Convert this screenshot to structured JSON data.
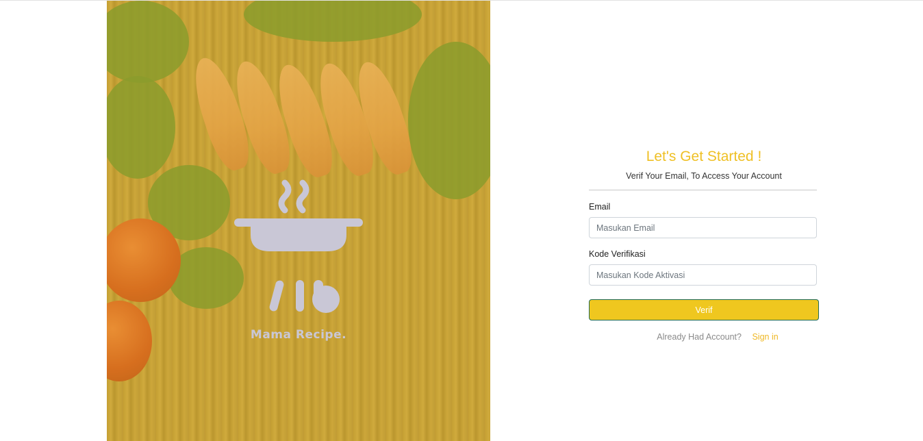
{
  "hero": {
    "logo_text": "Mama Recipe.",
    "colors": {
      "overlay": "#dcb428",
      "logo": "#c9c7d6"
    }
  },
  "form": {
    "title": "Let's Get Started !",
    "subtitle": "Verif Your Email, To Access Your Account",
    "email_label": "Email",
    "email_placeholder": "Masukan Email",
    "email_value": "",
    "code_label": "Kode Verifikasi",
    "code_placeholder": "Masukan Kode Aktivasi",
    "code_value": "",
    "submit_label": "Verif",
    "footer_text": "Already Had Account?",
    "signin_label": "Sign in"
  },
  "colors": {
    "accent": "#efc025",
    "button": "#efc71f",
    "link": "#efb825"
  }
}
